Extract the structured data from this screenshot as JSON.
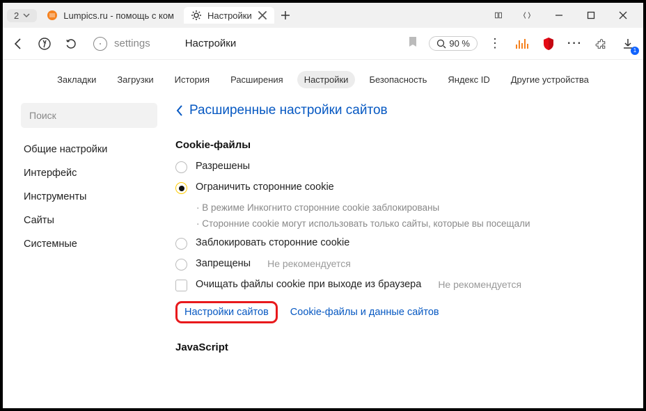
{
  "tabbar": {
    "counter": "2",
    "tab1_title": "Lumpics.ru - помощь с ком",
    "tab2_title": "Настройки"
  },
  "toolbar": {
    "addr_path": "settings",
    "addr_title": "Настройки",
    "zoom_text": "90 %",
    "dl_badge": "1"
  },
  "navrow": {
    "items": [
      "Закладки",
      "Загрузки",
      "История",
      "Расширения",
      "Настройки",
      "Безопасность",
      "Яндекс ID",
      "Другие устройства"
    ]
  },
  "sidebar": {
    "search_placeholder": "Поиск",
    "items": [
      "Общие настройки",
      "Интерфейс",
      "Инструменты",
      "Сайты",
      "Системные"
    ]
  },
  "main": {
    "back_title": "Расширенные настройки сайтов",
    "section_cookies": "Cookie-файлы",
    "opt_allow": "Разрешены",
    "opt_limit": "Ограничить сторонние cookie",
    "sub1": "· В режиме Инкогнито сторонние cookie заблокированы",
    "sub2": "· Сторонние cookie могут использовать только сайты, которые вы посещали",
    "opt_block3p": "Заблокировать сторонние cookie",
    "opt_deny": "Запрещены",
    "opt_clear": "Очищать файлы cookie при выходе из браузера",
    "hint_notrec": "Не рекомендуется",
    "link_sites": "Настройки сайтов",
    "link_data": "Cookie-файлы и данные сайтов",
    "section_js": "JavaScript"
  }
}
